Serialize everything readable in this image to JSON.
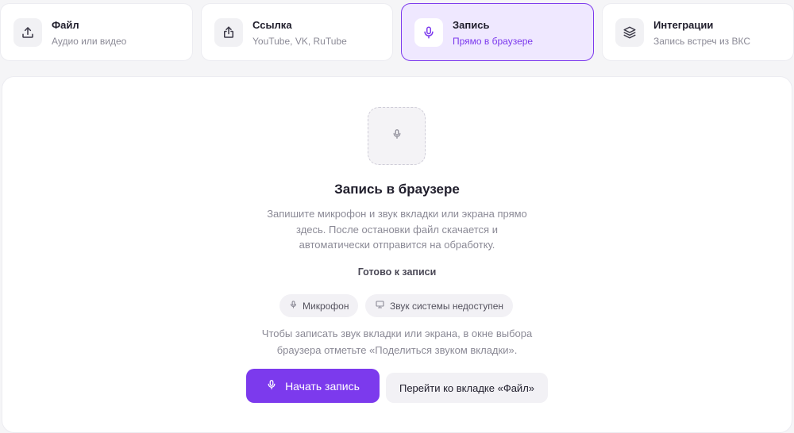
{
  "tabs": [
    {
      "title": "Файл",
      "subtitle": "Аудио или видео",
      "icon": "upload-icon",
      "active": false
    },
    {
      "title": "Ссылка",
      "subtitle": "YouTube, VK, RuTube",
      "icon": "share-icon",
      "active": false
    },
    {
      "title": "Запись",
      "subtitle": "Прямо в браузере",
      "icon": "microphone-icon",
      "active": true
    },
    {
      "title": "Интеграции",
      "subtitle": "Запись встреч из ВКС",
      "icon": "layers-icon",
      "active": false
    }
  ],
  "recorder": {
    "icon": "microphone-icon",
    "heading": "Запись в браузере",
    "description_lines": [
      "Запишите микрофон и звук вкладки или экрана прямо",
      "здесь. После остановки файл скачается и",
      "автоматически отправится на обработку."
    ],
    "status": "Готово к записи",
    "chips": [
      {
        "label": "Микрофон",
        "icon": "microphone-icon"
      },
      {
        "label": "Звук системы недоступен",
        "icon": "monitor-icon"
      }
    ],
    "hint_lines": [
      "Чтобы записать звук вкладки или экрана, в окне выбора",
      "браузера отметьте «Поделиться звуком вкладки»."
    ],
    "start_button": "Начать запись",
    "file_tab_button": "Перейти ко вкладке «Файл»"
  },
  "colors": {
    "accent": "#7c3aed",
    "accent_bg": "#efe8ff",
    "muted_text": "#8b8a96"
  }
}
